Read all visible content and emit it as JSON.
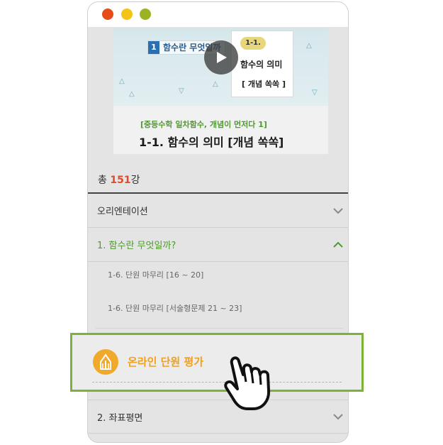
{
  "window": {
    "controls": [
      "close-dot",
      "minimize-dot",
      "maximize-dot"
    ]
  },
  "video": {
    "thumbnail": {
      "badge_number": "1",
      "badge_text": "함수란 무엇일까",
      "card_tag": "1-1.",
      "card_title": "함수의 의미",
      "card_subtitle": "[ 개념 쏙쏙 ]"
    },
    "play_icon": "play-icon",
    "course_subtitle": "[중등수학 일차함수, 개념이 먼저다 1]",
    "lecture_title": "1-1. 함수의 의미   [개념 쏙쏙]"
  },
  "lecture_count": {
    "prefix": "총 ",
    "number": "151",
    "suffix": "강"
  },
  "sections": [
    {
      "label": "오리엔테이션",
      "expanded": false
    },
    {
      "label": "1. 함수란 무엇일까?",
      "expanded": true
    },
    {
      "label": "2. 좌표평면",
      "expanded": false
    }
  ],
  "sub_items": [
    {
      "label": "1-6. 단원 마무리   [16 ~ 20]"
    },
    {
      "label": "1-6. 단원 마무리   [서술형문제 21 ~ 23]"
    }
  ],
  "online_eval": {
    "label": "온라인 단원 평가",
    "icon": "pencil-icon"
  },
  "colors": {
    "accent_green": "#4f9a2e",
    "highlight_border": "#7ab23a",
    "count_red": "#e04a2a",
    "eval_orange": "#f0a020"
  }
}
